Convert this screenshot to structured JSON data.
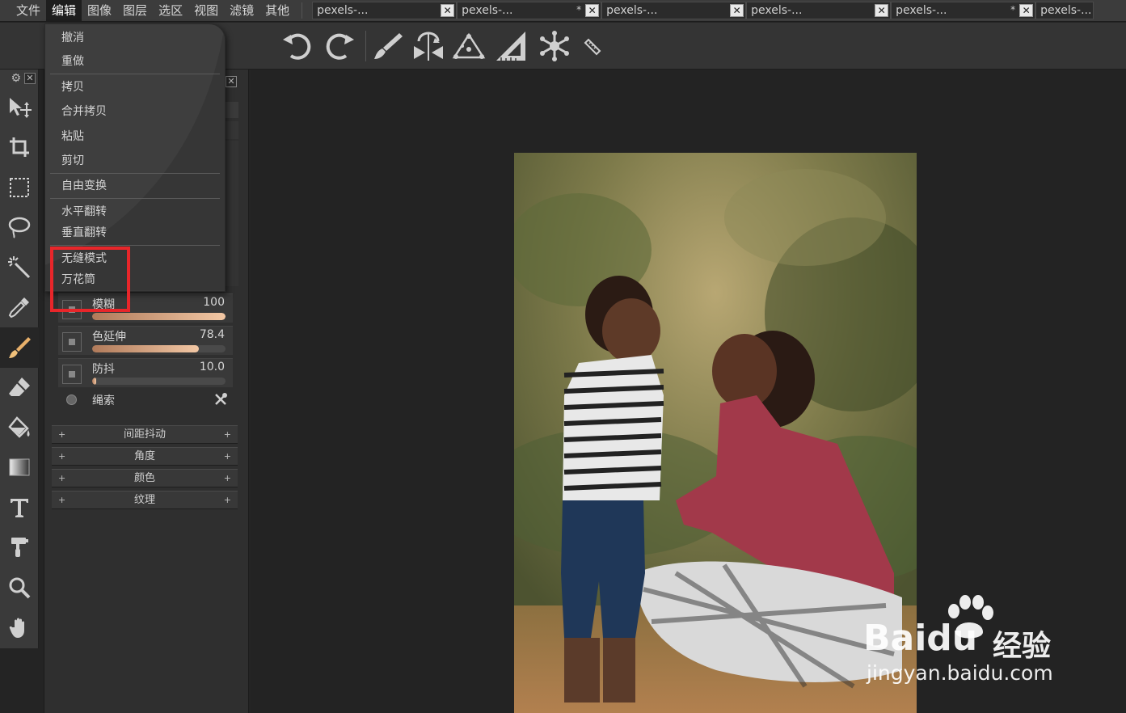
{
  "menubar": {
    "items": [
      "文件",
      "编辑",
      "图像",
      "图层",
      "选区",
      "视图",
      "滤镜",
      "其他"
    ],
    "active_index": 1
  },
  "tabs": [
    {
      "label": "pexels-...",
      "modified": ""
    },
    {
      "label": "pexels-...",
      "modified": "*"
    },
    {
      "label": "pexels-...",
      "modified": ""
    },
    {
      "label": "pexels-...",
      "modified": ""
    },
    {
      "label": "pexels-...",
      "modified": "*"
    },
    {
      "label": "pexels-...",
      "modified": ""
    }
  ],
  "toolbar": {
    "icons": [
      "undo-icon",
      "redo-icon",
      "brush-icon",
      "symmetry-icon",
      "triangle-dots-icon",
      "ruler-triangle-icon",
      "snowflake-icon",
      "small-ruler-icon"
    ]
  },
  "tools": {
    "icons": [
      "move-icon",
      "crop-icon",
      "marquee-icon",
      "lasso-icon",
      "magic-wand-icon",
      "eyedropper-icon",
      "brush-icon",
      "eraser-icon",
      "bucket-icon",
      "gradient-icon",
      "text-icon",
      "clone-stamp-icon",
      "zoom-icon",
      "hand-icon"
    ],
    "selected": "brush-icon"
  },
  "edit_menu": {
    "undo": "撤消",
    "redo": "重做",
    "copy": "拷贝",
    "copy_merged": "合并拷贝",
    "paste": "粘贴",
    "cut": "剪切",
    "free_transform": "自由变换",
    "flip_h": "水平翻转",
    "flip_v": "垂直翻转",
    "seamless": "无缝模式",
    "kaleidoscope": "万花筒"
  },
  "brush_settings": {
    "blur": {
      "label": "模糊",
      "value": "100",
      "fraction": 1.0
    },
    "color_stretch": {
      "label": "色延伸",
      "value": "78.4",
      "fraction": 0.8
    },
    "jitter": {
      "label": "防抖",
      "value": "10.0",
      "fraction": 0.03
    },
    "lasso_label": "绳索",
    "sections": [
      "间距抖动",
      "角度",
      "颜色",
      "纹理"
    ]
  },
  "watermark": {
    "brand_logo": "Baidu",
    "brand_cn": "经验",
    "url": "jingyan.baidu.com"
  },
  "colors": {
    "highlight": "#e8262a",
    "slider_fill": "#f2c7a4"
  }
}
